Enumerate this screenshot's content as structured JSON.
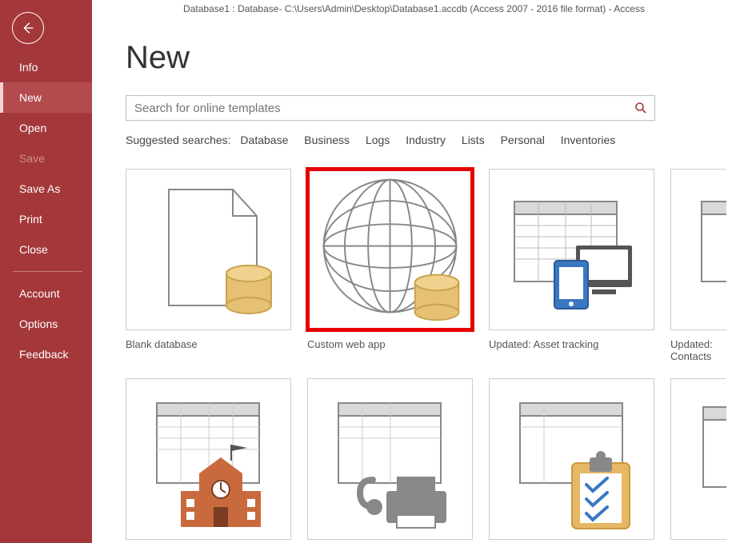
{
  "titlebar": "Database1 : Database- C:\\Users\\Admin\\Desktop\\Database1.accdb (Access 2007 - 2016 file format)  -  Access",
  "page_title": "New",
  "sidebar": {
    "items": [
      {
        "label": "Info",
        "state": "normal"
      },
      {
        "label": "New",
        "state": "active"
      },
      {
        "label": "Open",
        "state": "normal"
      },
      {
        "label": "Save",
        "state": "disabled"
      },
      {
        "label": "Save As",
        "state": "normal"
      },
      {
        "label": "Print",
        "state": "normal"
      },
      {
        "label": "Close",
        "state": "normal"
      }
    ],
    "footer": [
      {
        "label": "Account"
      },
      {
        "label": "Options"
      },
      {
        "label": "Feedback"
      }
    ]
  },
  "search": {
    "placeholder": "Search for online templates",
    "icon_color": "#a4373a"
  },
  "suggested": {
    "label": "Suggested searches:",
    "terms": [
      "Database",
      "Business",
      "Logs",
      "Industry",
      "Lists",
      "Personal",
      "Inventories"
    ]
  },
  "templates": [
    {
      "label": "Blank database",
      "icon": "blank-db",
      "highlight": false
    },
    {
      "label": "Custom web app",
      "icon": "web-app",
      "highlight": true
    },
    {
      "label": "Updated: Asset tracking",
      "icon": "asset-tracking",
      "highlight": false
    },
    {
      "label": "Updated: Contacts",
      "icon": "contacts",
      "highlight": false
    },
    {
      "label": "",
      "icon": "students",
      "highlight": false
    },
    {
      "label": "",
      "icon": "faxes",
      "highlight": false
    },
    {
      "label": "",
      "icon": "tasks",
      "highlight": false
    },
    {
      "label": "",
      "icon": "other",
      "highlight": false
    }
  ]
}
